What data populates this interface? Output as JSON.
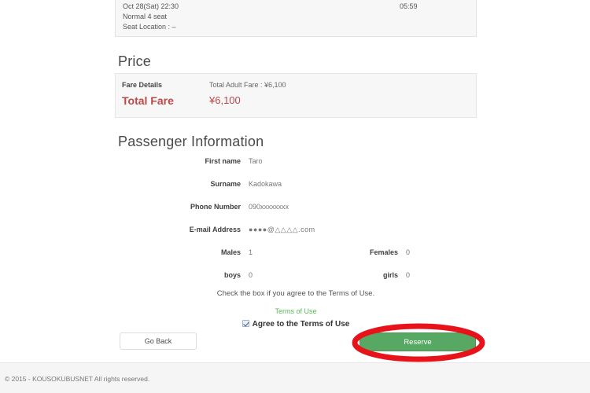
{
  "trip": {
    "departure_datetime": "Oct 28(Sat) 22:30",
    "arrival_time": "05:59",
    "seat_type": "Normal 4 seat",
    "seat_location": "Seat Location : –"
  },
  "price": {
    "heading": "Price",
    "fare_details_label": "Fare Details",
    "fare_details_value": "Total Adult Fare : ¥6,100",
    "total_fare_label": "Total Fare",
    "total_fare_value": "¥6,100",
    "accent_color": "#b94a48"
  },
  "passenger": {
    "heading": "Passenger Information",
    "fields": [
      {
        "label": "First name",
        "value": "Taro"
      },
      {
        "label": "Surname",
        "value": "Kadokawa"
      },
      {
        "label": "Phone Number",
        "value": "090xxxxxxxx"
      },
      {
        "label": "E-mail Address",
        "value": "●●●●@△△△△.com"
      }
    ],
    "counts": [
      {
        "label": "Males",
        "value": "1",
        "label2": "Females",
        "value2": "0"
      },
      {
        "label": "boys",
        "value": "0",
        "label2": "girls",
        "value2": "0"
      }
    ]
  },
  "terms": {
    "note": "Check the box if you agree to the Terms of Use.",
    "link_label": "Terms of Use",
    "link_color": "#5cb85c",
    "agree_label": "Agree to the Terms of Use",
    "agree_checked": true
  },
  "actions": {
    "go_back_label": "Go Back",
    "reserve_label": "Reserve",
    "reserve_color": "#56a863",
    "annotation_color": "#e8131a"
  },
  "footer": {
    "copyright": "© 2015 - KOUSOKUBUSNET All rights reserved."
  }
}
